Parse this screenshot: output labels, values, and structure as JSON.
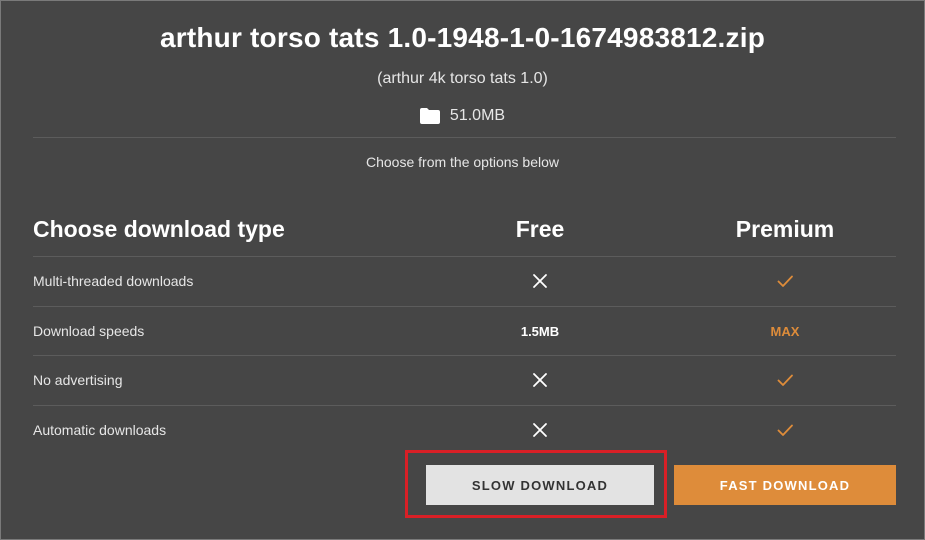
{
  "file": {
    "title": "arthur torso tats 1.0-1948-1-0-1674983812.zip",
    "subtitle": "(arthur 4k torso tats 1.0)",
    "size": "51.0MB",
    "size_icon": "folder-icon"
  },
  "prompt": "Choose from the options below",
  "table": {
    "header": {
      "type": "Choose download type",
      "free": "Free",
      "premium": "Premium"
    },
    "rows": [
      {
        "label": "Multi-threaded downloads",
        "free": {
          "icon": "x-icon"
        },
        "premium": {
          "icon": "check-icon"
        }
      },
      {
        "label": "Download speeds",
        "free": {
          "text": "1.5MB"
        },
        "premium": {
          "text": "MAX"
        }
      },
      {
        "label": "No advertising",
        "free": {
          "icon": "x-icon"
        },
        "premium": {
          "icon": "check-icon"
        }
      },
      {
        "label": "Automatic downloads",
        "free": {
          "icon": "x-icon"
        },
        "premium": {
          "icon": "check-icon"
        }
      }
    ]
  },
  "buttons": {
    "slow": "SLOW DOWNLOAD",
    "fast": "FAST DOWNLOAD"
  },
  "colors": {
    "background": "#464646",
    "accent": "#de8c3a",
    "highlight": "#d91f26",
    "slow_button": "#e3e3e3"
  }
}
